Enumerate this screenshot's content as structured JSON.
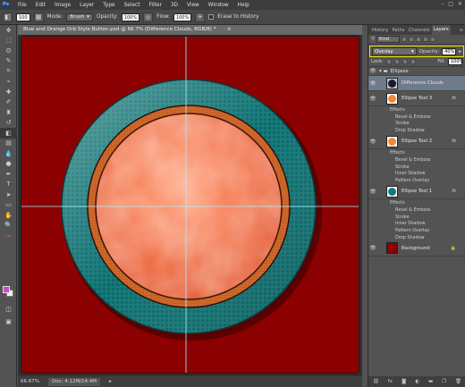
{
  "app": {
    "logo": "Ps"
  },
  "menu": [
    "File",
    "Edit",
    "Image",
    "Layer",
    "Type",
    "Select",
    "Filter",
    "3D",
    "View",
    "Window",
    "Help"
  ],
  "window_controls": [
    "–",
    "□",
    "✕"
  ],
  "options": {
    "brush_size": "100",
    "mode_label": "Mode:",
    "mode_value": "Brush",
    "opacity_label": "Opacity:",
    "opacity_value": "100%",
    "flow_label": "Flow:",
    "flow_value": "100%",
    "erase_history_label": "Erase to History"
  },
  "document": {
    "tab_title": "Blue and Orange Orb Style Button.psd @ 66.7% (Difference Clouds, RGB/8) *",
    "close": "×"
  },
  "status": {
    "zoom": "66.67%",
    "doc_size": "Doc: 4.12M/14.4M"
  },
  "panel": {
    "tabs": [
      "History",
      "Paths",
      "Channels",
      "Layers"
    ],
    "active_tab": "Layers",
    "kind_label": "Kind",
    "blend_mode": "Overlay",
    "opacity_label": "Opacity:",
    "opacity_value": "40%",
    "lock_label": "Lock:",
    "fill_label": "Fill:",
    "fill_value": "100%",
    "group_name": "Ellipses",
    "layers": [
      {
        "name": "Difference Clouds",
        "selected": true,
        "thumb_color": "#1a1a2e"
      },
      {
        "name": "Ellipse Tool 3",
        "fx": "fx",
        "thumb_color": "#f08a3a",
        "effects_label": "Effects",
        "effects": [
          "Bevel & Emboss",
          "Stroke",
          "Drop Shadow"
        ]
      },
      {
        "name": "Ellipse Tool 2",
        "fx": "fx",
        "thumb_color": "#f08a3a",
        "effects_label": "Effects",
        "effects": [
          "Bevel & Emboss",
          "Stroke",
          "Inner Shadow",
          "Pattern Overlay"
        ]
      },
      {
        "name": "Ellipse Tool 1",
        "fx": "fx",
        "thumb_color": "#137a7a",
        "effects_label": "Effects",
        "effects": [
          "Bevel & Emboss",
          "Stroke",
          "Inner Shadow",
          "Pattern Overlay",
          "Drop Shadow"
        ]
      },
      {
        "name": "Background",
        "thumb_color": "#8b0000"
      }
    ],
    "bottom_icons": [
      "link-icon",
      "fx",
      "mask-icon",
      "adjust-icon",
      "folder-icon",
      "new-layer-icon",
      "trash-icon"
    ]
  },
  "colors": {
    "canvas_bg": "#8b0000",
    "teal_ring": "#137a7a",
    "orange_orb": "#f07040",
    "foreground": "#c84cc8",
    "background": "#f0f0f0"
  }
}
